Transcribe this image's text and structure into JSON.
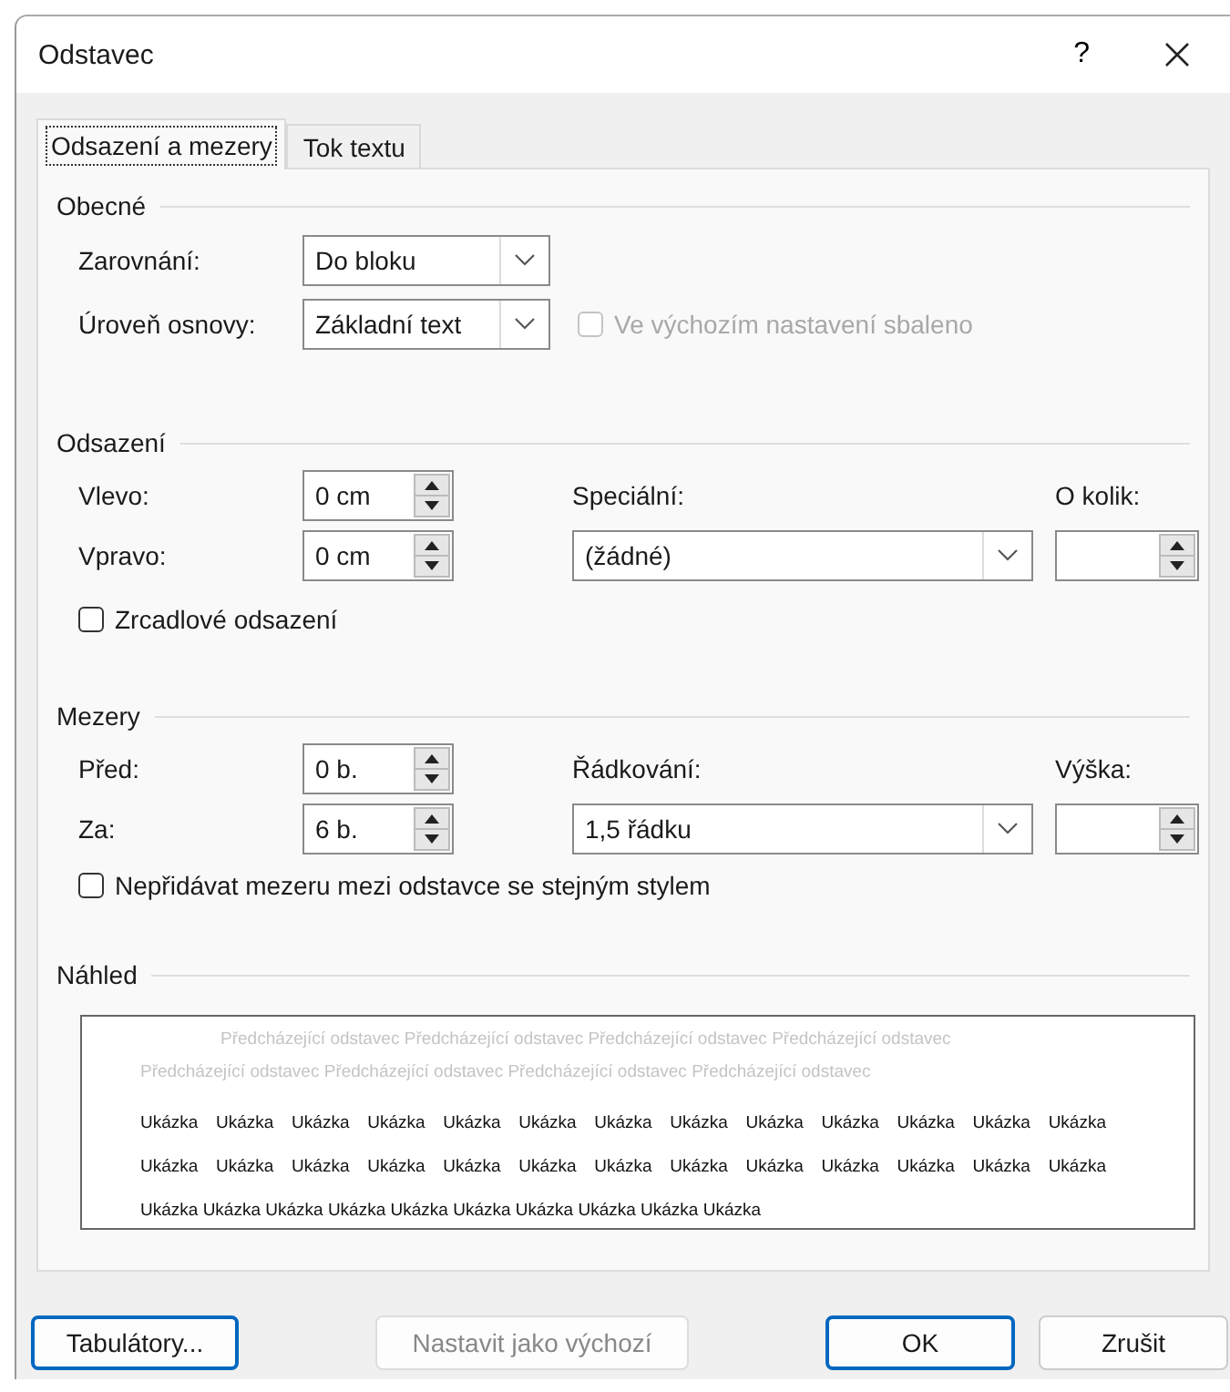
{
  "window": {
    "title": "Odstavec",
    "help": "?"
  },
  "tabs": [
    {
      "label": "Odsazení a mezery",
      "selected": true
    },
    {
      "label": "Tok textu",
      "selected": false
    }
  ],
  "general": {
    "title": "Obecné",
    "alignment": {
      "label": "Zarovnání:",
      "value": "Do bloku"
    },
    "outline_level": {
      "label": "Úroveň osnovy:",
      "value": "Základní text"
    },
    "collapsed": {
      "label": "Ve výchozím nastavení sbaleno",
      "checked": false,
      "disabled": true
    }
  },
  "indentation": {
    "title": "Odsazení",
    "left": {
      "label": "Vlevo:",
      "value": "0 cm"
    },
    "right": {
      "label": "Vpravo:",
      "value": "0 cm"
    },
    "special": {
      "label": "Speciální:",
      "value": "(žádné)"
    },
    "by": {
      "label": "O kolik:"
    },
    "mirror": {
      "label": "Zrcadlové odsazení",
      "checked": false,
      "disabled": false
    }
  },
  "spacing": {
    "title": "Mezery",
    "before": {
      "label": "Před:",
      "value": "0 b."
    },
    "after": {
      "label": "Za:",
      "value": "6 b."
    },
    "line_spacing": {
      "label": "Řádkování:",
      "value": "1,5 řádku"
    },
    "at": {
      "label": "Výška:"
    },
    "no_space": {
      "label": "Nepřidávat mezeru mezi odstavce se stejným stylem",
      "checked": false,
      "disabled": false
    }
  },
  "preview": {
    "title": "Náhled",
    "previous_lines": [
      "Předcházející odstavec Předcházející odstavec Předcházející odstavec Předcházející odstavec",
      "Předcházející odstavec Předcházející odstavec Předcházející odstavec Předcházející odstavec"
    ],
    "sample_lines": [
      "Ukázka Ukázka Ukázka Ukázka Ukázka Ukázka Ukázka Ukázka Ukázka Ukázka Ukázka Ukázka Ukázka",
      "Ukázka Ukázka Ukázka Ukázka Ukázka Ukázka Ukázka Ukázka Ukázka Ukázka Ukázka Ukázka Ukázka",
      "Ukázka Ukázka Ukázka Ukázka Ukázka Ukázka Ukázka Ukázka Ukázka Ukázka"
    ]
  },
  "buttons": [
    {
      "label": "Tabulátory...",
      "disabled": false,
      "focused": true
    },
    {
      "label": "Nastavit jako výchozí",
      "disabled": true,
      "focused": false
    },
    {
      "label": "OK",
      "disabled": false,
      "focused": true
    },
    {
      "label": "Zrušit",
      "disabled": false,
      "focused": false
    }
  ]
}
